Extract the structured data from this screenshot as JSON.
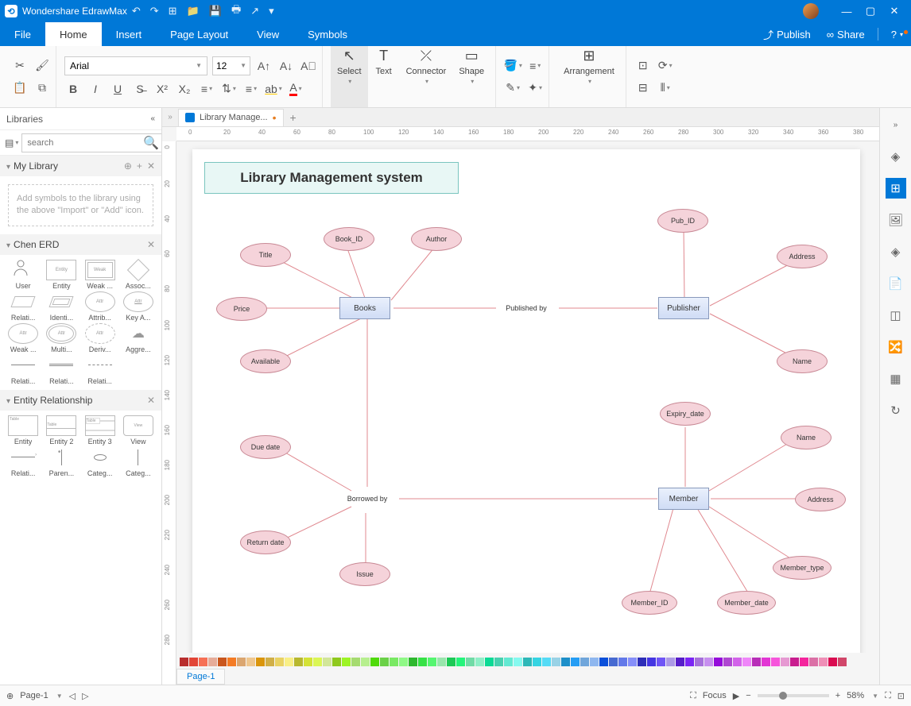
{
  "app": {
    "title": "Wondershare EdrawMax"
  },
  "topbar": {
    "publish": "Publish",
    "share": "Share"
  },
  "menu": {
    "file": "File",
    "home": "Home",
    "insert": "Insert",
    "page": "Page Layout",
    "view": "View",
    "symbols": "Symbols"
  },
  "ribbon": {
    "font": "Arial",
    "size": "12",
    "select": "Select",
    "text": "Text",
    "connector": "Connector",
    "shape": "Shape",
    "arrangement": "Arrangement"
  },
  "libraries": {
    "title": "Libraries",
    "search_ph": "search",
    "mylib": "My Library",
    "hint": "Add symbols to the library using the above \"Import\" or \"Add\" icon.",
    "chen": {
      "title": "Chen ERD",
      "items": [
        "User",
        "Entity",
        "Weak ...",
        "Assoc...",
        "Relati...",
        "Identi...",
        "Attrib...",
        "Key A...",
        "Weak ...",
        "Multi...",
        "Deriv...",
        "Aggre...",
        "Relati...",
        "Relati...",
        "Relati..."
      ]
    },
    "er": {
      "title": "Entity Relationship",
      "items": [
        "Entity",
        "Entity 2",
        "Entity 3",
        "View",
        "Relati...",
        "Paren...",
        "Categ...",
        "Categ..."
      ]
    }
  },
  "doc": {
    "tab": "Library Manage...",
    "title": "Library Management system"
  },
  "diagram": {
    "entities": {
      "books": "Books",
      "publisher": "Publisher",
      "member": "Member"
    },
    "relations": {
      "pubby": "Published by",
      "borby": "Borrowed by"
    },
    "attrs": {
      "price": "Price",
      "title": "Title",
      "bookid": "Book_ID",
      "author": "Author",
      "avail": "Available",
      "pubid": "Pub_ID",
      "paddr": "Address",
      "pname": "Name",
      "due": "Due date",
      "ret": "Return date",
      "issue": "Issue",
      "exp": "Expiry_date",
      "mname": "Name",
      "maddr": "Address",
      "mtype": "Member_type",
      "mdate": "Member_date",
      "mid": "Member_ID"
    }
  },
  "status": {
    "page": "Page-1",
    "focus": "Focus",
    "zoom": "58%"
  },
  "ruler_h": [
    0,
    20,
    40,
    60,
    80,
    100,
    120,
    140,
    160,
    180,
    200,
    220,
    240,
    260,
    280,
    300,
    320,
    340,
    360,
    380
  ],
  "ruler_v": [
    0,
    20,
    40,
    60,
    80,
    100,
    120,
    140,
    160,
    180,
    200,
    220,
    240,
    260,
    280
  ]
}
